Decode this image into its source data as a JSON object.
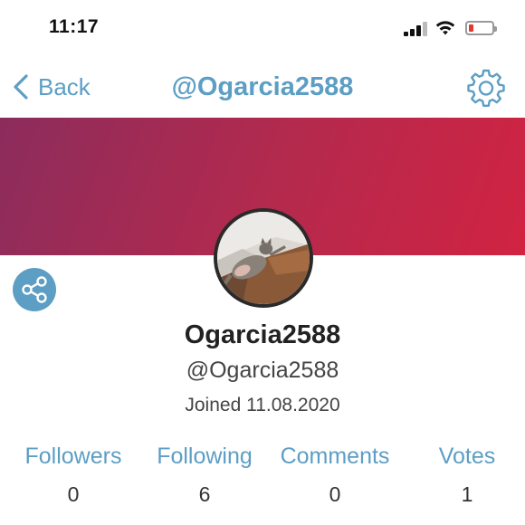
{
  "status_bar": {
    "time": "11:17",
    "battery_level": 0.12,
    "battery_color": "#e5362f"
  },
  "nav": {
    "back_label": "Back",
    "title": "@Ogarcia2588",
    "accent_color": "#5d9ec4",
    "back_icon": "chevron-left-icon",
    "settings_icon": "gear-icon"
  },
  "banner": {
    "gradient_start": "#8c2c5c",
    "gradient_end": "#d12342"
  },
  "profile": {
    "display_name": "Ogarcia2588",
    "handle": "@Ogarcia2588",
    "joined": "Joined 11.08.2020",
    "share_icon": "share-icon"
  },
  "stats": [
    {
      "label": "Followers",
      "value": "0"
    },
    {
      "label": "Following",
      "value": "6"
    },
    {
      "label": "Comments",
      "value": "0"
    },
    {
      "label": "Votes",
      "value": "1"
    }
  ]
}
